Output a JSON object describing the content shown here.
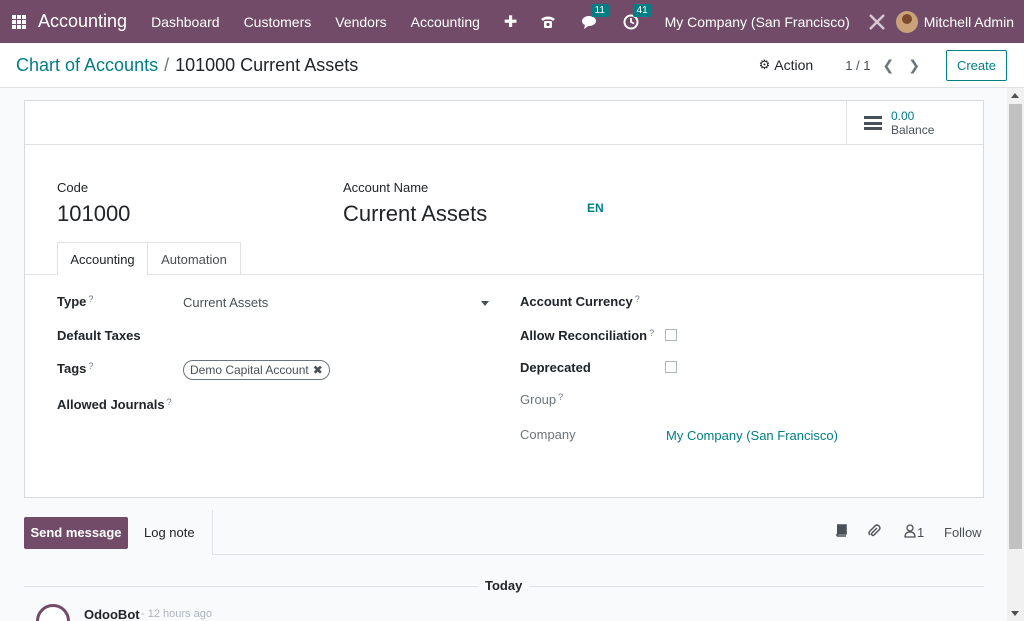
{
  "topnav": {
    "app_name": "Accounting",
    "menu": [
      "Dashboard",
      "Customers",
      "Vendors",
      "Accounting"
    ],
    "messages_count": "11",
    "activities_count": "41",
    "company": "My Company (San Francisco)",
    "user": "Mitchell Admin",
    "accent_color": "#714b67"
  },
  "control": {
    "breadcrumb_parent": "Chart of Accounts",
    "breadcrumb_sep": "/",
    "breadcrumb_current": "101000 Current Assets",
    "action_label": "Action",
    "pager": "1 / 1",
    "create_label": "Create"
  },
  "form": {
    "balance_value": "0.00",
    "balance_label": "Balance",
    "code_label": "Code",
    "code_value": "101000",
    "name_label": "Account Name",
    "name_value": "Current Assets",
    "lang": "EN",
    "tabs": [
      "Accounting",
      "Automation"
    ],
    "left": {
      "type_label": "Type",
      "type_value": "Current Assets",
      "taxes_label": "Default Taxes",
      "tags_label": "Tags",
      "tag_value": "Demo Capital Account",
      "journals_label": "Allowed Journals"
    },
    "right": {
      "currency_label": "Account Currency",
      "reconcile_label": "Allow Reconciliation",
      "deprecated_label": "Deprecated",
      "group_label": "Group",
      "company_label": "Company",
      "company_value": "My Company (San Francisco)"
    },
    "help_mark": "?"
  },
  "chatter": {
    "send_label": "Send message",
    "log_label": "Log note",
    "followers": "1",
    "follow_label": "Follow",
    "today_label": "Today",
    "author": "OdooBot",
    "time": "- 12 hours ago"
  }
}
